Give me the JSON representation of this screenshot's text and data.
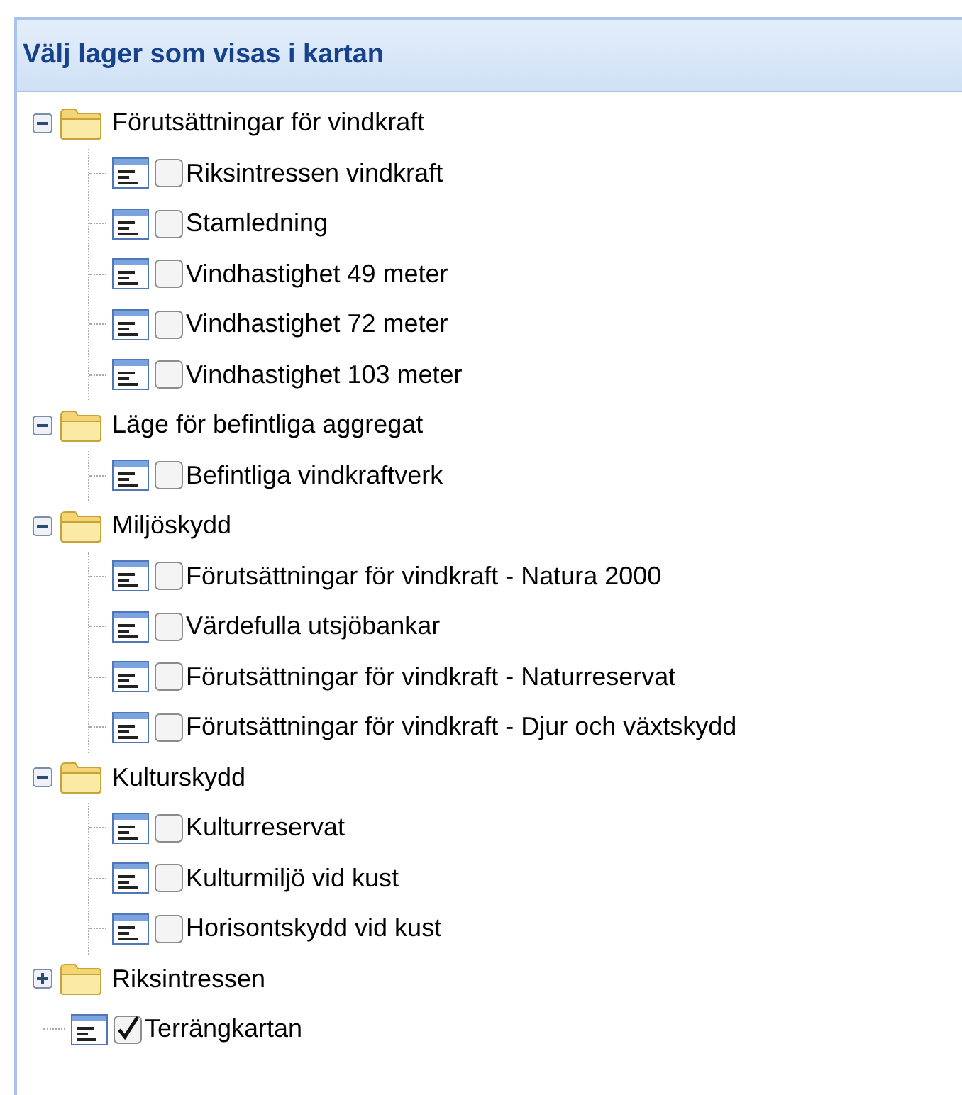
{
  "panel": {
    "title": "Välj lager som visas i kartan"
  },
  "tree": [
    {
      "kind": "folder",
      "label": "Förutsättningar för vindkraft",
      "expanded": true,
      "children": [
        {
          "kind": "layer",
          "label": "Riksintressen vindkraft",
          "checked": false
        },
        {
          "kind": "layer",
          "label": "Stamledning",
          "checked": false
        },
        {
          "kind": "layer",
          "label": "Vindhastighet 49 meter",
          "checked": false
        },
        {
          "kind": "layer",
          "label": "Vindhastighet 72 meter",
          "checked": false
        },
        {
          "kind": "layer",
          "label": "Vindhastighet 103 meter",
          "checked": false
        }
      ]
    },
    {
      "kind": "folder",
      "label": "Läge för befintliga aggregat",
      "expanded": true,
      "children": [
        {
          "kind": "layer",
          "label": "Befintliga vindkraftverk",
          "checked": false
        }
      ]
    },
    {
      "kind": "folder",
      "label": "Miljöskydd",
      "expanded": true,
      "children": [
        {
          "kind": "layer",
          "label": "Förutsättningar för vindkraft - Natura 2000",
          "checked": false
        },
        {
          "kind": "layer",
          "label": "Värdefulla utsjöbankar",
          "checked": false
        },
        {
          "kind": "layer",
          "label": "Förutsättningar för vindkraft - Naturreservat",
          "checked": false
        },
        {
          "kind": "layer",
          "label": "Förutsättningar för vindkraft - Djur och växtskydd",
          "checked": false
        }
      ]
    },
    {
      "kind": "folder",
      "label": "Kulturskydd",
      "expanded": true,
      "children": [
        {
          "kind": "layer",
          "label": "Kulturreservat",
          "checked": false
        },
        {
          "kind": "layer",
          "label": "Kulturmiljö vid kust",
          "checked": false
        },
        {
          "kind": "layer",
          "label": "Horisontskydd vid kust",
          "checked": false
        }
      ]
    },
    {
      "kind": "folder",
      "label": "Riksintressen",
      "expanded": false
    },
    {
      "kind": "layer",
      "label": "Terrängkartan",
      "checked": true
    }
  ]
}
